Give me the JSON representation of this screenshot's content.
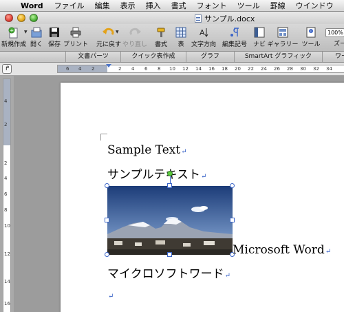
{
  "menubar": {
    "app_name": "Word",
    "items": [
      "ファイル",
      "編集",
      "表示",
      "挿入",
      "書式",
      "フォント",
      "ツール",
      "罫線",
      "ウインドウ"
    ]
  },
  "window": {
    "title": "サンプル.docx"
  },
  "toolbar": {
    "new_label": "新規作成",
    "open_label": "開く",
    "save_label": "保存",
    "print_label": "プリント",
    "undo_label": "元に戻す",
    "redo_label": "やり直し",
    "format_label": "書式",
    "table_label": "表",
    "text_direction_label": "文字方向",
    "edit_mark_label": "編集記号",
    "navi_label": "ナビ",
    "gallery_label": "ギャラリー",
    "tools_label": "ツール",
    "zoom_label": "ズー",
    "zoom_value": "100%"
  },
  "ribbon": {
    "tabs": [
      "文書パーツ",
      "クイック表作成",
      "グラフ",
      "SmartArt グラフィック",
      "ワー"
    ]
  },
  "ruler": {
    "h_numbers": [
      "6",
      "4",
      "2",
      "2",
      "4",
      "6",
      "8",
      "10",
      "12",
      "14",
      "16",
      "18",
      "20",
      "22",
      "24",
      "26",
      "28",
      "30",
      "32",
      "34"
    ],
    "v_numbers": [
      "4",
      "2",
      "2",
      "4",
      "6",
      "8",
      "10",
      "12",
      "14",
      "16"
    ]
  },
  "document": {
    "line1": "Sample Text",
    "line2": "サンプルテキスト",
    "image_caption": "Microsoft Word",
    "line4": "マイクロソフトワード",
    "paragraph_mark": "↵"
  },
  "colors": {
    "paragraph_mark": "#3a64c8",
    "selection_handle": "#3a64c8",
    "rotation_handle": "#5fcc40",
    "sky_top": "#1c3c78",
    "sky_bottom": "#8fb0dd"
  }
}
